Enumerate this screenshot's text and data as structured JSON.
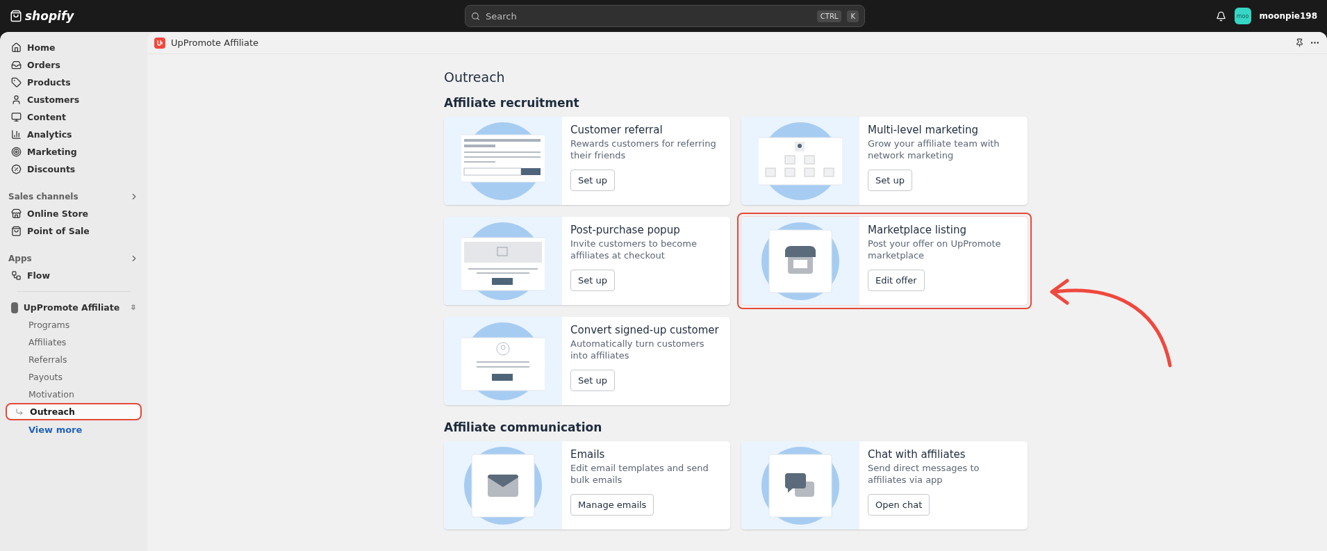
{
  "topbar": {
    "logo": "shopify",
    "search": {
      "placeholder": "Search",
      "keys": [
        "CTRL",
        "K"
      ]
    },
    "avatar": "moo",
    "user": "moonpie198"
  },
  "sidebar": {
    "main": [
      {
        "label": "Home"
      },
      {
        "label": "Orders"
      },
      {
        "label": "Products"
      },
      {
        "label": "Customers"
      },
      {
        "label": "Content"
      },
      {
        "label": "Analytics"
      },
      {
        "label": "Marketing"
      },
      {
        "label": "Discounts"
      }
    ],
    "sales_channels": {
      "heading": "Sales channels",
      "items": [
        {
          "label": "Online Store"
        },
        {
          "label": "Point of Sale"
        }
      ]
    },
    "apps": {
      "heading": "Apps",
      "items": [
        {
          "label": "Flow"
        }
      ]
    },
    "app": {
      "label": "UpPromote Affiliate",
      "pinned": true,
      "children": [
        {
          "label": "Programs",
          "selected": false,
          "highlighted": false
        },
        {
          "label": "Affiliates",
          "selected": false,
          "highlighted": false
        },
        {
          "label": "Referrals",
          "selected": false,
          "highlighted": false
        },
        {
          "label": "Payouts",
          "selected": false,
          "highlighted": false
        },
        {
          "label": "Motivation",
          "selected": false,
          "highlighted": false
        },
        {
          "label": "Outreach",
          "selected": true,
          "highlighted": true
        }
      ]
    },
    "view_more": "View more"
  },
  "app_header": {
    "title": "UpPromote Affiliate"
  },
  "page": {
    "title": "Outreach",
    "sections": [
      {
        "title": "Affiliate recruitment",
        "cards": [
          {
            "kind": "form",
            "title": "Customer referral",
            "description": "Rewards customers for referring their friends",
            "button": "Set up",
            "highlighted": false
          },
          {
            "kind": "network",
            "title": "Multi-level marketing",
            "description": "Grow your affiliate team with network marketing",
            "button": "Set up",
            "highlighted": false
          },
          {
            "kind": "popup",
            "title": "Post-purchase popup",
            "description": "Invite customers to become affiliates at checkout",
            "button": "Set up",
            "highlighted": false
          },
          {
            "kind": "store",
            "title": "Marketplace listing",
            "description": "Post your offer on UpPromote marketplace",
            "button": "Edit offer",
            "highlighted": true
          },
          {
            "kind": "profile",
            "title": "Convert signed-up customer",
            "description": "Automatically turn customers into affiliates",
            "button": "Set up",
            "highlighted": false
          }
        ]
      },
      {
        "title": "Affiliate communication",
        "cards": [
          {
            "kind": "email",
            "title": "Emails",
            "description": "Edit email templates and send bulk emails",
            "button": "Manage emails",
            "highlighted": false
          },
          {
            "kind": "chat",
            "title": "Chat with affiliates",
            "description": "Send direct messages to affiliates via app",
            "button": "Open chat",
            "highlighted": false
          }
        ]
      }
    ]
  }
}
